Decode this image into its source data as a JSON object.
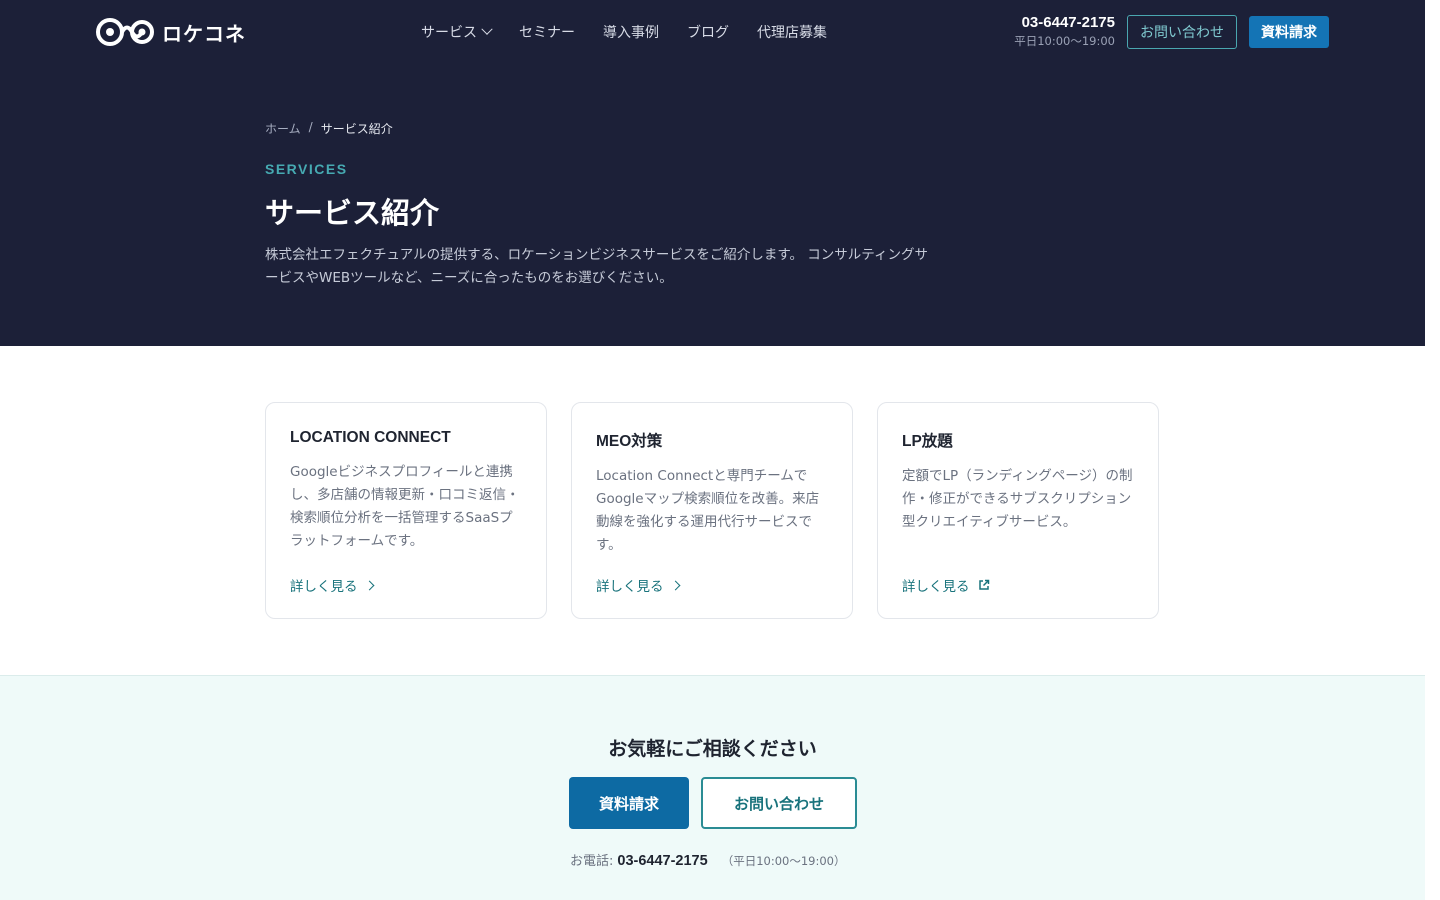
{
  "header": {
    "logo_text": "ロケコネ",
    "nav": [
      {
        "label": "サービス",
        "has_dropdown": true
      },
      {
        "label": "セミナー"
      },
      {
        "label": "導入事例"
      },
      {
        "label": "ブログ"
      },
      {
        "label": "代理店募集"
      }
    ],
    "phone": "03-6447-2175",
    "phone_hours": "平日10:00〜19:00",
    "contact_label": "お問い合わせ",
    "docs_label": "資料請求"
  },
  "hero": {
    "breadcrumb": {
      "home": "ホーム",
      "separator": "/",
      "current": "サービス紹介"
    },
    "eyebrow": "SERVICES",
    "title": "サービス紹介",
    "description": "株式会社エフェクチュアルの提供する、ロケーションビジネスサービスをご紹介します。 コンサルティングサービスやWEBツールなど、ニーズに合ったものをお選びください。"
  },
  "cards": [
    {
      "title": "LOCATION CONNECT",
      "description": "Googleビジネスプロフィールと連携し、多店舗の情報更新・口コミ返信・検索順位分析を一括管理するSaaSプラットフォームです。",
      "link_label": "詳しく見る",
      "link_icon": "chevron-right-icon"
    },
    {
      "title": "MEO対策",
      "description": "Location Connectと専門チームでGoogleマップ検索順位を改善。来店動線を強化する運用代行サービスです。",
      "link_label": "詳しく見る",
      "link_icon": "chevron-right-icon"
    },
    {
      "title": "LP放題",
      "description": "定額でLP（ランディングページ）の制作・修正ができるサブスクリプション型クリエイティブサービス。",
      "link_label": "詳しく見る",
      "link_icon": "external-link-icon"
    }
  ],
  "cta": {
    "title": "お気軽にご相談ください",
    "docs_label": "資料請求",
    "contact_label": "お問い合わせ",
    "phone_label": "お電話:",
    "phone": "03-6447-2175",
    "phone_hours": "（平日10:00〜19:00）"
  },
  "colors": {
    "hero_bg": "#1c2038",
    "accent_teal": "#46aab2",
    "primary_blue": "#1474b5",
    "cta_bg": "#effaf9"
  }
}
